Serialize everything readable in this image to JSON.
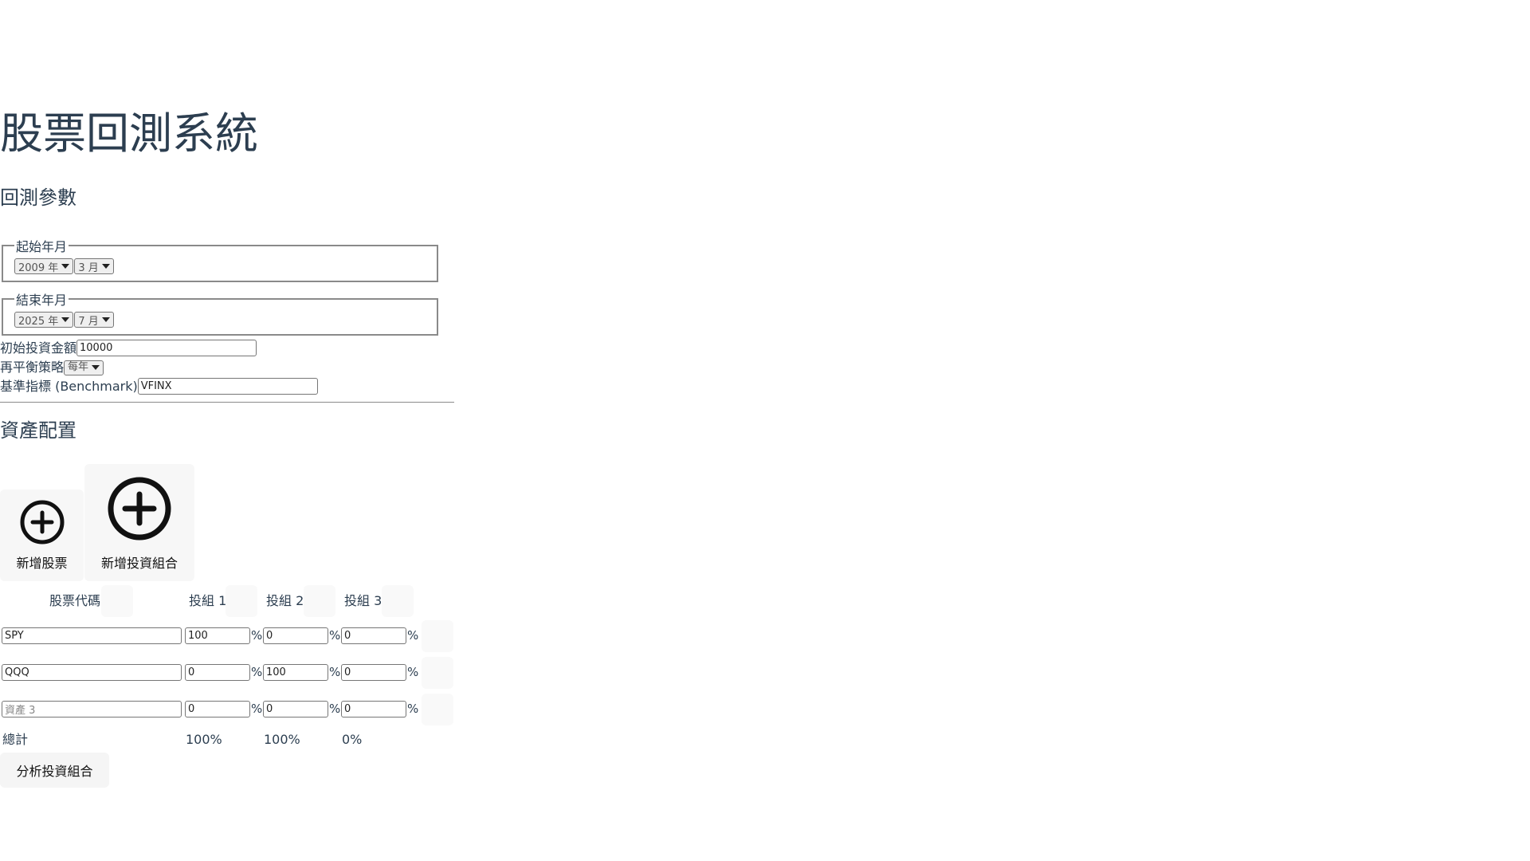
{
  "page_title": "股票回測系統",
  "params": {
    "section_title": "回測參數",
    "start": {
      "legend": "起始年月",
      "year": "2009 年",
      "month": "3 月"
    },
    "end": {
      "legend": "結束年月",
      "year": "2025 年",
      "month": "7 月"
    },
    "initial_amount_label": "初始投資金額",
    "initial_amount_value": "10000",
    "rebalance_label": "再平衡策略",
    "rebalance_value": "每年",
    "benchmark_label": "基準指標 (Benchmark)",
    "benchmark_value": "VFINX"
  },
  "allocation": {
    "section_title": "資產配置",
    "add_stock_label": "新增股票",
    "add_portfolio_label": "新增投資組合",
    "headers": {
      "ticker": "股票代碼",
      "p1": "投組 1",
      "p2": "投組 2",
      "p3": "投組 3"
    },
    "percent_sign": "%",
    "rows": [
      {
        "ticker": "SPY",
        "ticker_placeholder": "",
        "p1": "100",
        "p2": "0",
        "p3": "0"
      },
      {
        "ticker": "QQQ",
        "ticker_placeholder": "",
        "p1": "0",
        "p2": "100",
        "p3": "0"
      },
      {
        "ticker": "",
        "ticker_placeholder": "資產 3",
        "p1": "0",
        "p2": "0",
        "p3": "0"
      }
    ],
    "total_label": "總計",
    "totals": {
      "p1": "100%",
      "p2": "100%",
      "p3": "0%"
    },
    "analyze_label": "分析投資組合"
  },
  "icons": {
    "add_stock": "plus-circle-icon",
    "add_portfolio": "plus-circle-icon"
  }
}
